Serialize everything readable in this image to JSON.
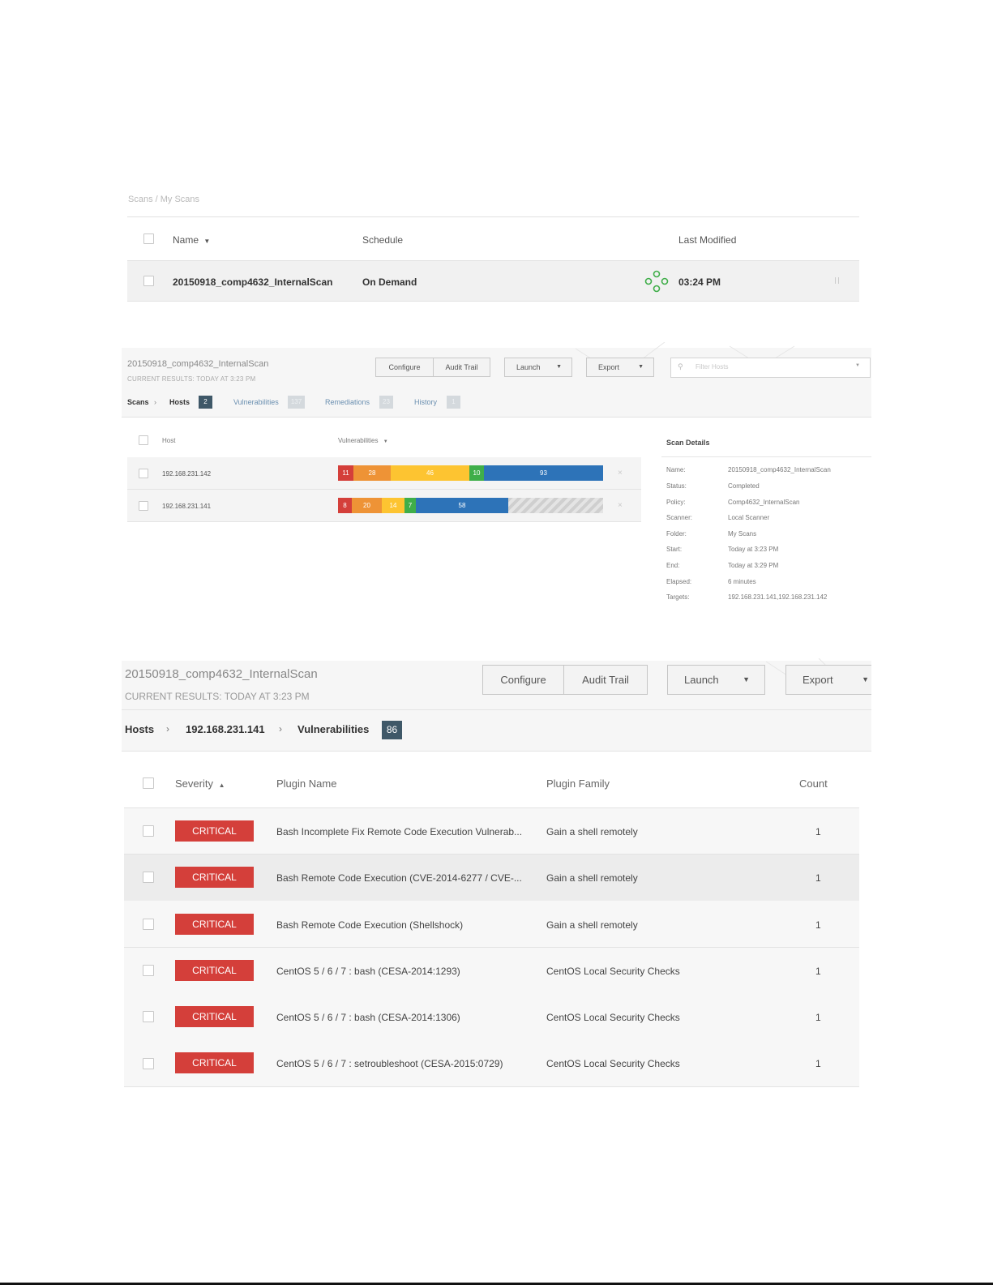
{
  "scans_list": {
    "breadcrumb": "Scans / My Scans",
    "columns": {
      "name": "Name",
      "schedule": "Schedule",
      "last_modified": "Last Modified"
    },
    "row": {
      "name": "20150918_comp4632_InternalScan",
      "schedule": "On Demand",
      "last_modified": "03:24 PM"
    }
  },
  "hosts_view": {
    "title": "20150918_comp4632_InternalScan",
    "subtitle": "CURRENT RESULTS: TODAY AT 3:23 PM",
    "buttons": {
      "configure": "Configure",
      "audit_trail": "Audit Trail",
      "launch": "Launch",
      "export": "Export"
    },
    "filter_placeholder": "Filter Hosts",
    "tabs": {
      "scans": "Scans",
      "hosts": "Hosts",
      "hosts_count": "2",
      "vulnerabilities": "Vulnerabilities",
      "vulnerabilities_count": "137",
      "remediations": "Remediations",
      "remediations_count": "23",
      "history": "History",
      "history_count": "1"
    },
    "columns": {
      "host": "Host",
      "vulnerabilities": "Vulnerabilities"
    },
    "hosts": [
      {
        "ip": "192.168.231.142",
        "counts": {
          "critical": "11",
          "high": "28",
          "medium": "46",
          "low": "10",
          "info": "93"
        }
      },
      {
        "ip": "192.168.231.141",
        "counts": {
          "critical": "8",
          "high": "20",
          "medium": "14",
          "low": "7",
          "info": "58"
        }
      }
    ],
    "scan_details": {
      "title": "Scan Details",
      "fields": [
        {
          "label": "Name:",
          "value": "20150918_comp4632_InternalScan"
        },
        {
          "label": "Status:",
          "value": "Completed"
        },
        {
          "label": "Policy:",
          "value": "Comp4632_InternalScan"
        },
        {
          "label": "Scanner:",
          "value": "Local Scanner"
        },
        {
          "label": "Folder:",
          "value": "My Scans"
        },
        {
          "label": "Start:",
          "value": "Today at 3:23 PM"
        },
        {
          "label": "End:",
          "value": "Today at 3:29 PM"
        },
        {
          "label": "Elapsed:",
          "value": "6 minutes"
        },
        {
          "label": "Targets:",
          "value": "192.168.231.141,192.168.231.142"
        }
      ]
    }
  },
  "vulns_view": {
    "title": "20150918_comp4632_InternalScan",
    "subtitle": "CURRENT RESULTS: TODAY AT 3:23 PM",
    "buttons": {
      "configure": "Configure",
      "audit_trail": "Audit Trail",
      "launch": "Launch",
      "export": "Export"
    },
    "breadcrumb": {
      "hosts": "Hosts",
      "host": "192.168.231.141",
      "vulnerabilities": "Vulnerabilities",
      "count": "86"
    },
    "columns": {
      "severity": "Severity",
      "plugin_name": "Plugin Name",
      "plugin_family": "Plugin Family",
      "count": "Count"
    },
    "rows": [
      {
        "severity": "CRITICAL",
        "plugin": "Bash Incomplete Fix Remote Code Execution Vulnerab...",
        "family": "Gain a shell remotely",
        "count": "1"
      },
      {
        "severity": "CRITICAL",
        "plugin": "Bash Remote Code Execution (CVE-2014-6277 / CVE-...",
        "family": "Gain a shell remotely",
        "count": "1"
      },
      {
        "severity": "CRITICAL",
        "plugin": "Bash Remote Code Execution (Shellshock)",
        "family": "Gain a shell remotely",
        "count": "1"
      },
      {
        "severity": "CRITICAL",
        "plugin": "CentOS 5 / 6 / 7 : bash (CESA-2014:1293)",
        "family": "CentOS Local Security Checks",
        "count": "1"
      },
      {
        "severity": "CRITICAL",
        "plugin": "CentOS 5 / 6 / 7 : bash (CESA-2014:1306)",
        "family": "CentOS Local Security Checks",
        "count": "1"
      },
      {
        "severity": "CRITICAL",
        "plugin": "CentOS 5 / 6 / 7 : setroubleshoot (CESA-2015:0729)",
        "family": "CentOS Local Security Checks",
        "count": "1"
      }
    ]
  },
  "colors": {
    "critical": "#d43f3a",
    "high": "#ee9336",
    "medium": "#fdc431",
    "low": "#3fae49",
    "info": "#2d73b8",
    "badge_dark": "#3f5868",
    "badge_light": "#d4d9dd"
  }
}
